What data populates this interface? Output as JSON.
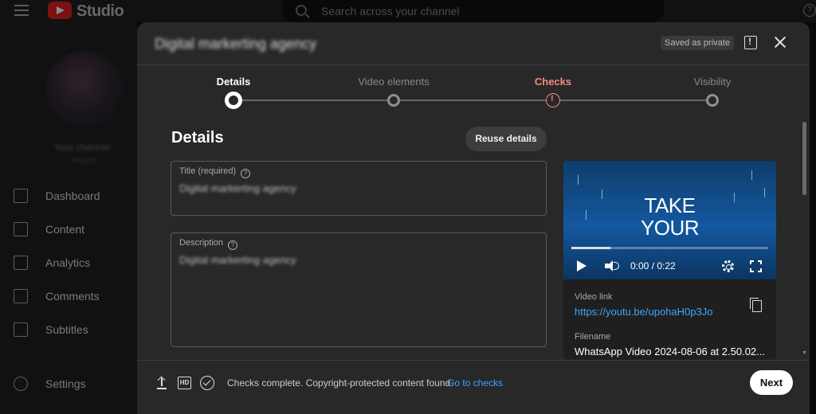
{
  "shell": {
    "studio_label": "Studio",
    "search_placeholder": "Search across your channel",
    "channel_name": "Your channel",
    "channel_sub": "Prashi",
    "nav": [
      {
        "label": "Dashboard",
        "icon": "dashboard-icon"
      },
      {
        "label": "Content",
        "icon": "content-icon",
        "active": true
      },
      {
        "label": "Analytics",
        "icon": "analytics-icon"
      },
      {
        "label": "Comments",
        "icon": "comments-icon"
      },
      {
        "label": "Subtitles",
        "icon": "subtitles-icon"
      },
      {
        "label": "Settings",
        "icon": "settings-icon"
      }
    ]
  },
  "modal": {
    "title": "Digital markerting agency",
    "saved_badge": "Saved as private",
    "steps": [
      {
        "label": "Details",
        "state": "current"
      },
      {
        "label": "Video elements",
        "state": "pending"
      },
      {
        "label": "Checks",
        "state": "warning"
      },
      {
        "label": "Visibility",
        "state": "pending"
      }
    ],
    "details_heading": "Details",
    "reuse_button": "Reuse details",
    "title_field": {
      "label": "Title (required)",
      "value": "Digital markerting agency"
    },
    "description_field": {
      "label": "Description",
      "value": "Digital markerting agency"
    },
    "video": {
      "overlay_line1": "TAKE",
      "overlay_line2": "YOUR",
      "time": "0:00 / 0:22",
      "progress": 0.2,
      "link_label": "Video link",
      "link": "https://youtu.be/upohaH0p3Jo",
      "filename_label": "Filename",
      "filename": "WhatsApp Video 2024-08-06 at 2.50.02..."
    },
    "footer": {
      "hd_label": "HD",
      "checks_text": "Checks complete. Copyright-protected content found.",
      "goto_link": "Go to checks",
      "next_button": "Next"
    }
  },
  "colors": {
    "accent_link": "#3ea6ff",
    "warning": "#f28b82",
    "brand_red": "#e02020"
  }
}
